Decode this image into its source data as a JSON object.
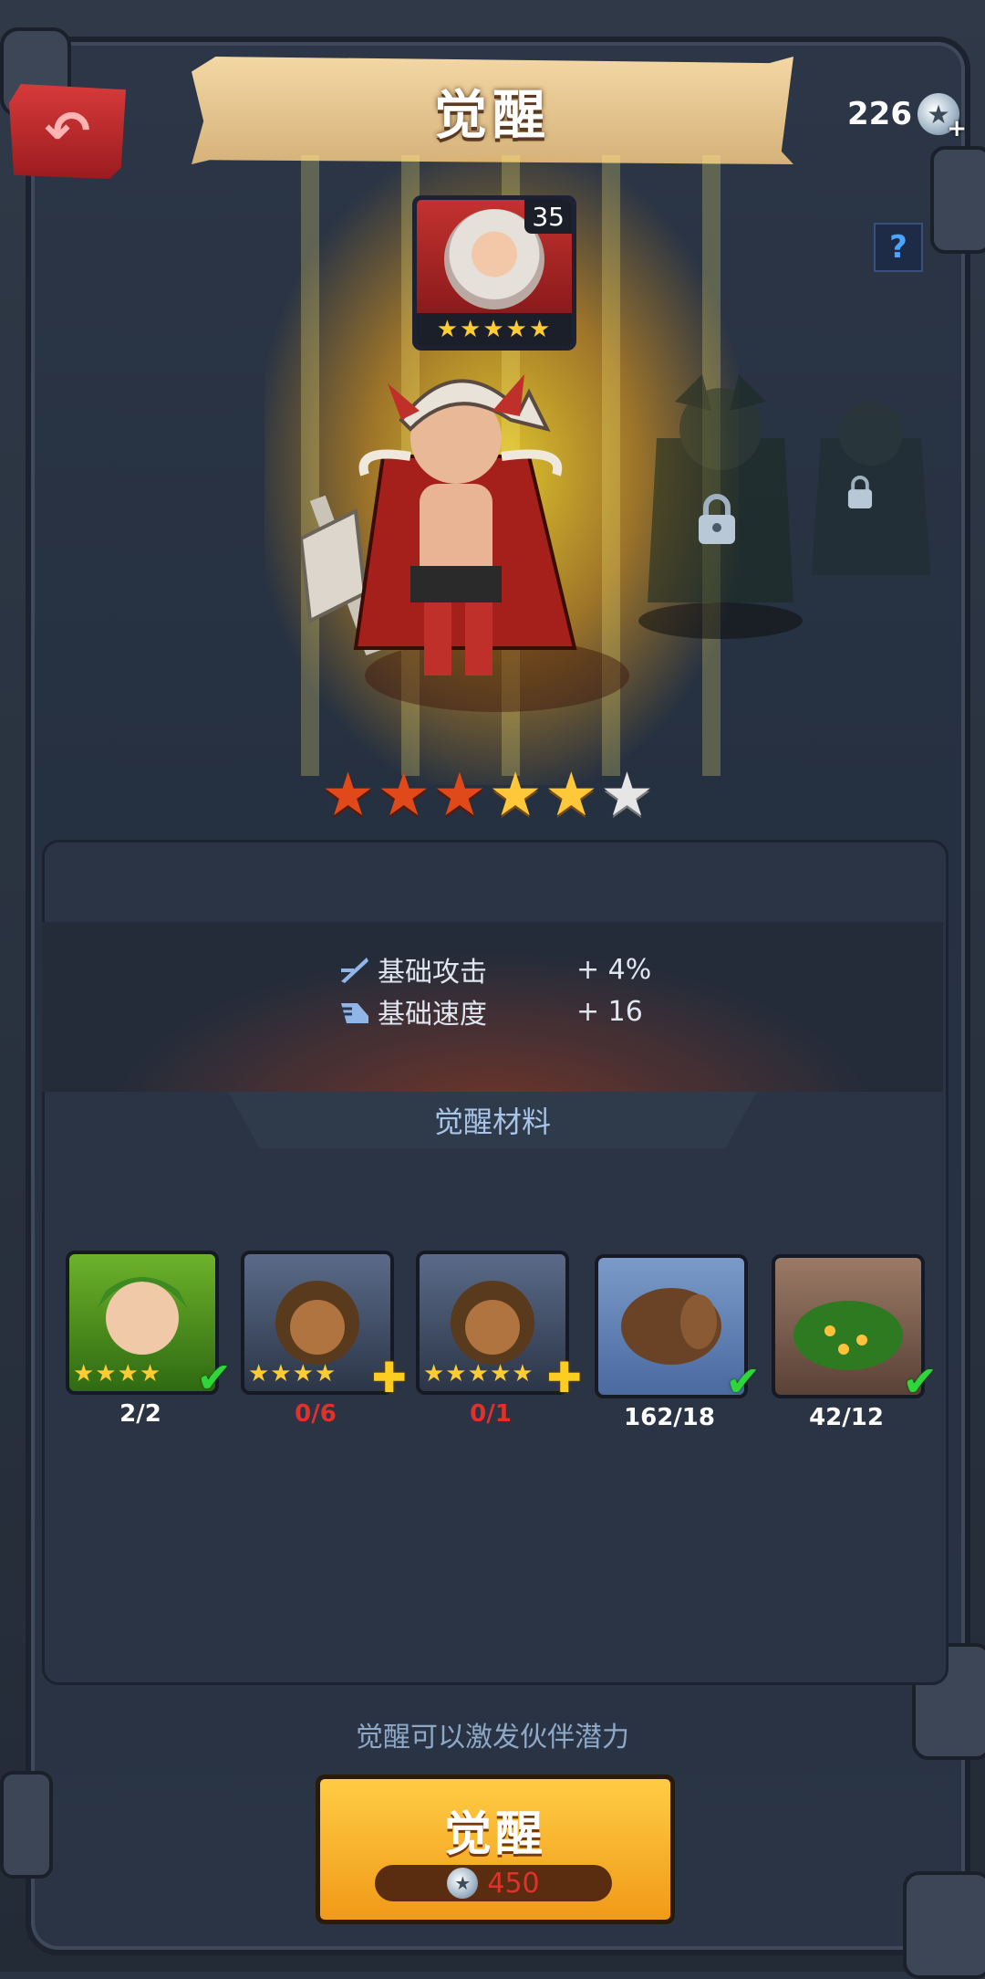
{
  "header": {
    "title": "觉醒",
    "currency_value": "226"
  },
  "hero": {
    "level": "35",
    "portrait_stars": "★★★★★",
    "awaken_stars": {
      "red": 3,
      "gold": 2,
      "gray": 1
    }
  },
  "stats": [
    {
      "label": "基础攻击",
      "value": "+ 4%"
    },
    {
      "label": "基础速度",
      "value": "+ 16"
    }
  ],
  "materials": {
    "header": "觉醒材料",
    "items": [
      {
        "name": "green-hero-card",
        "stars": "★★★★",
        "count": "2/2",
        "status": "check",
        "count_color": "white"
      },
      {
        "name": "brown-hero-card",
        "stars": "★★★★",
        "count": "0/6",
        "status": "plus",
        "count_color": "red"
      },
      {
        "name": "brown-hero-card",
        "stars": "★★★★★",
        "count": "0/1",
        "status": "plus",
        "count_color": "red"
      },
      {
        "name": "wood-log-item",
        "stars": "",
        "count": "162/18",
        "status": "check",
        "count_color": "white"
      },
      {
        "name": "flower-bush-item",
        "stars": "",
        "count": "42/12",
        "status": "check",
        "count_color": "white"
      }
    ]
  },
  "footer": {
    "hint": "觉醒可以激发伙伴潜力",
    "button_label": "觉醒",
    "cost": "450"
  },
  "colors": {
    "accent_gold": "#ffc83a",
    "accent_red": "#e3302a",
    "check_green": "#2fd63a"
  }
}
